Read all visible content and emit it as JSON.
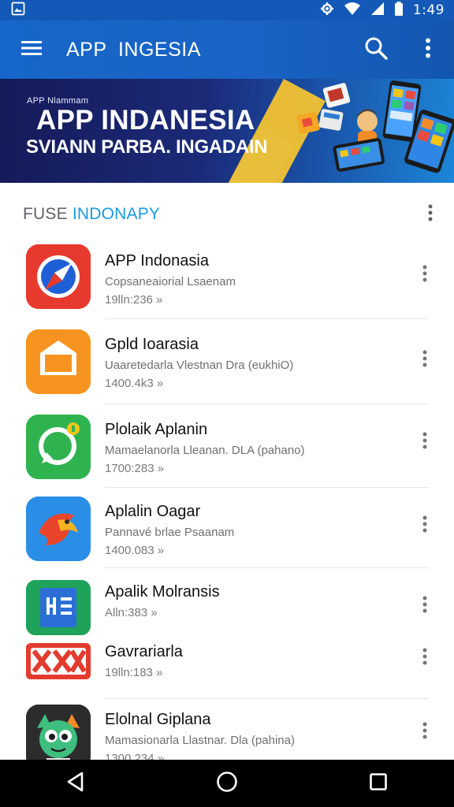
{
  "status_bar": {
    "time": "1:49"
  },
  "app_bar": {
    "title": "APP  INGESIA"
  },
  "banner": {
    "small_label": "APP Nlammam",
    "title": "APP INDANESIA",
    "subtitle": "SVIANN PARBA. INGADAIN"
  },
  "section": {
    "title_prefix": "FUSE ",
    "title_accent": "INDONAPY"
  },
  "apps": [
    {
      "name": "APP Indonasia",
      "desc": "Copsaneaiorial Lsaenam",
      "meta": "19lln:236  »"
    },
    {
      "name": "Gpld Ioarasia",
      "desc": "Uaaretedarla Vlestnan Dra (eukhiO)",
      "meta": "1400.4k3  »"
    },
    {
      "name": "Plolaik Aplanin",
      "desc": "Mamaelanorla Lleanan. DLA (pahano)",
      "meta": "1700:283  »"
    },
    {
      "name": "Aplalin Oagar",
      "desc": "Pannavé brlae Psaanam",
      "meta": "1400.083  »"
    },
    {
      "name": "Apalik Molransis",
      "desc": "",
      "meta": "Alln:383  »"
    },
    {
      "name": "Gavrariarla",
      "desc": "",
      "meta": "19lln:183  »"
    },
    {
      "name": "Elolnal Giplana",
      "desc": "Mamasionarla Llastnar. Dla (pahina)",
      "meta": "1300.234  »"
    }
  ],
  "colors": {
    "primary": "#1a63c4",
    "status_bar": "#1459b8",
    "banner_dark": "#151a58",
    "accent": "#1a9be0"
  }
}
